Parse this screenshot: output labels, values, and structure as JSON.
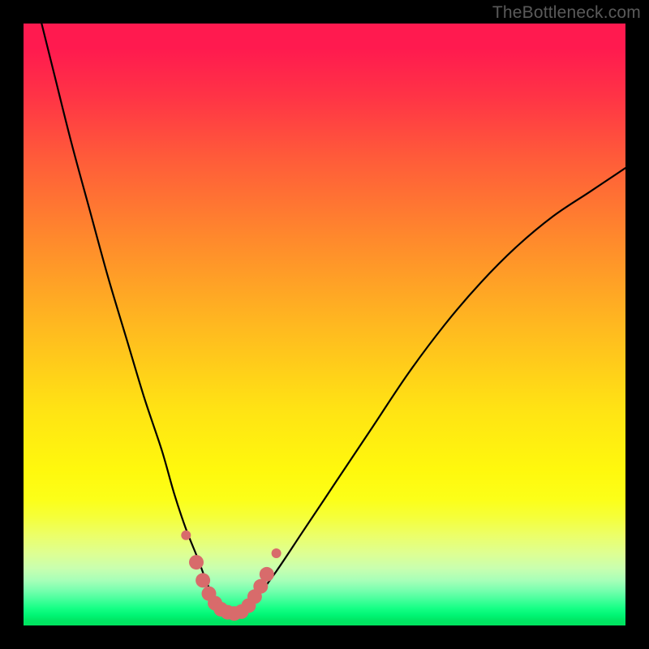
{
  "watermark": "TheBottleneck.com",
  "colors": {
    "frame": "#000000",
    "curve": "#000000",
    "marker_fill": "#d86b6b",
    "marker_stroke": "#c95a5a"
  },
  "chart_data": {
    "type": "line",
    "title": "",
    "xlabel": "",
    "ylabel": "",
    "xlim": [
      0,
      100
    ],
    "ylim": [
      0,
      100
    ],
    "grid": false,
    "legend": false,
    "background": "rainbow-gradient (red top → green bottom)",
    "note": "V-shaped bottleneck curve; plot has no visible axes, ticks, or labels. Values below are visual estimates of curve height as percentage of plot height (100 = top of colored area, 0 = bottom) against horizontal position in percent.",
    "series": [
      {
        "name": "bottleneck-curve",
        "x": [
          3,
          5,
          8,
          11,
          14,
          17,
          20,
          23,
          25,
          27,
          29,
          30.5,
          32,
          33.5,
          35,
          37,
          39,
          42,
          46,
          52,
          58,
          64,
          70,
          76,
          82,
          88,
          94,
          100
        ],
        "values": [
          100,
          92,
          80,
          69,
          58,
          48,
          38,
          29,
          22,
          16,
          11,
          7,
          4,
          2.5,
          2,
          2.8,
          5,
          9,
          15,
          24,
          33,
          42,
          50,
          57,
          63,
          68,
          72,
          76
        ]
      }
    ],
    "markers": {
      "name": "highlighted-points",
      "note": "Thick salmon dotted/round markers near the minimum of the V, visually read as (x%, y%) of plot area.",
      "points": [
        {
          "x": 27.0,
          "y": 15.0,
          "size": 6
        },
        {
          "x": 28.7,
          "y": 10.5,
          "size": 9
        },
        {
          "x": 29.8,
          "y": 7.5,
          "size": 9
        },
        {
          "x": 30.8,
          "y": 5.3,
          "size": 9
        },
        {
          "x": 31.8,
          "y": 3.7,
          "size": 9
        },
        {
          "x": 32.8,
          "y": 2.7,
          "size": 9
        },
        {
          "x": 33.9,
          "y": 2.2,
          "size": 9
        },
        {
          "x": 35.0,
          "y": 2.0,
          "size": 9
        },
        {
          "x": 36.2,
          "y": 2.3,
          "size": 9
        },
        {
          "x": 37.4,
          "y": 3.3,
          "size": 9
        },
        {
          "x": 38.4,
          "y": 4.8,
          "size": 9
        },
        {
          "x": 39.4,
          "y": 6.5,
          "size": 9
        },
        {
          "x": 40.4,
          "y": 8.5,
          "size": 9
        },
        {
          "x": 42.0,
          "y": 12.0,
          "size": 6
        }
      ]
    }
  }
}
